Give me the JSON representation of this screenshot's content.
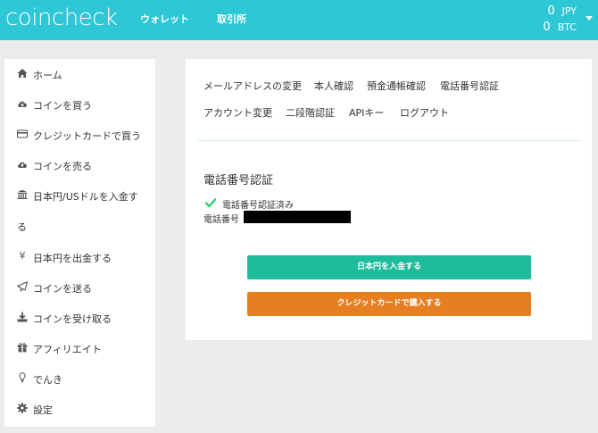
{
  "header": {
    "logo": "coincheck",
    "nav": {
      "wallet": "ウォレット",
      "exchange": "取引所"
    },
    "balances": [
      {
        "amount": "0",
        "currency": "JPY"
      },
      {
        "amount": "0",
        "currency": "BTC"
      }
    ]
  },
  "sidebar": {
    "items": [
      {
        "icon": "home-icon",
        "label": "ホーム"
      },
      {
        "icon": "cloud-download-icon",
        "label": "コインを買う"
      },
      {
        "icon": "credit-card-icon",
        "label": "クレジットカードで買う"
      },
      {
        "icon": "cloud-upload-icon",
        "label": "コインを売る"
      },
      {
        "icon": "bank-icon",
        "label": "日本円/USドルを入金す",
        "label_cont": "る"
      },
      {
        "icon": "yen-icon",
        "label": "日本円を出金する"
      },
      {
        "icon": "paper-plane-icon",
        "label": "コインを送る"
      },
      {
        "icon": "download-icon",
        "label": "コインを受け取る"
      },
      {
        "icon": "gift-icon",
        "label": "アフィリエイト"
      },
      {
        "icon": "lightbulb-icon",
        "label": "でんき"
      },
      {
        "icon": "gear-icon",
        "label": "設定"
      }
    ]
  },
  "main": {
    "tabs": [
      "メールアドレスの変更",
      "本人確認",
      "預金通帳確認",
      "電話番号認証",
      "アカウント変更",
      "二段階認証",
      "APIキー",
      "ログアウト"
    ],
    "section_title": "電話番号認証",
    "verified_text": "電話番号認証済み",
    "phone_label": "電話番号",
    "buttons": {
      "deposit": "日本円を入金する",
      "credit": "クレジットカードで購入する"
    }
  },
  "colors": {
    "header": "#2ec7d6",
    "deposit_button": "#1fbc9c",
    "credit_button": "#e67e22",
    "check": "#2ecc71"
  }
}
